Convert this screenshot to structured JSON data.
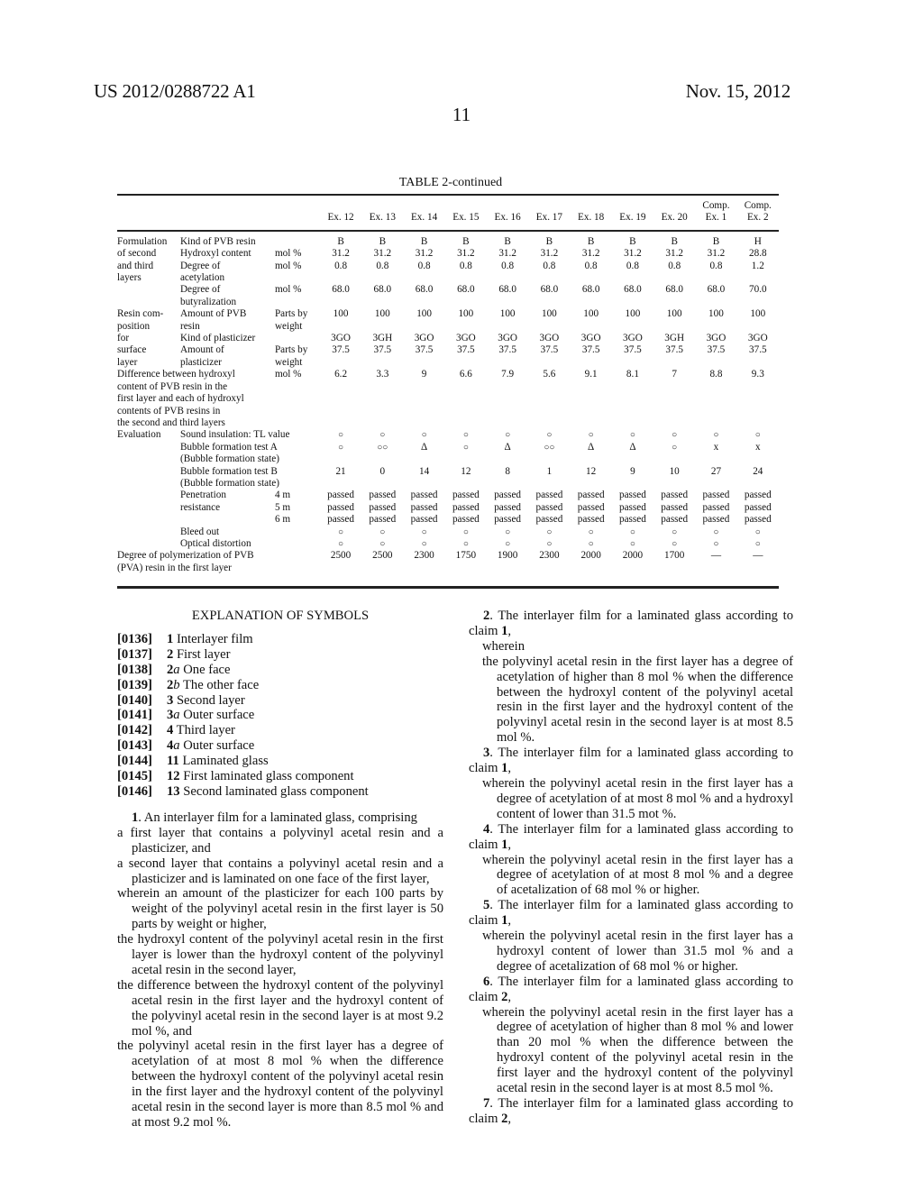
{
  "header": {
    "publication_number": "US 2012/0288722 A1",
    "date": "Nov. 15, 2012",
    "page_number": "11"
  },
  "table": {
    "title": "TABLE 2-continued",
    "columns": [
      "Ex. 12",
      "Ex. 13",
      "Ex. 14",
      "Ex. 15",
      "Ex. 16",
      "Ex. 17",
      "Ex. 18",
      "Ex. 19",
      "Ex. 20",
      "Comp.\nEx. 1",
      "Comp.\nEx. 2"
    ],
    "column_labels": [
      {
        "line1": "",
        "line2": "Ex. 12"
      },
      {
        "line1": "",
        "line2": "Ex. 13"
      },
      {
        "line1": "",
        "line2": "Ex. 14"
      },
      {
        "line1": "",
        "line2": "Ex. 15"
      },
      {
        "line1": "",
        "line2": "Ex. 16"
      },
      {
        "line1": "",
        "line2": "Ex. 17"
      },
      {
        "line1": "",
        "line2": "Ex. 18"
      },
      {
        "line1": "",
        "line2": "Ex. 19"
      },
      {
        "line1": "",
        "line2": "Ex. 20"
      },
      {
        "line1": "Comp.",
        "line2": "Ex. 1"
      },
      {
        "line1": "Comp.",
        "line2": "Ex. 2"
      }
    ],
    "rows": [
      {
        "group": "Formulation",
        "item": "Kind of PVB resin",
        "unit": "",
        "values": [
          "B",
          "B",
          "B",
          "B",
          "B",
          "B",
          "B",
          "B",
          "B",
          "B",
          "H"
        ]
      },
      {
        "group": "of second",
        "item": "Hydroxyl content",
        "unit": "mol %",
        "values": [
          "31.2",
          "31.2",
          "31.2",
          "31.2",
          "31.2",
          "31.2",
          "31.2",
          "31.2",
          "31.2",
          "31.2",
          "28.8"
        ]
      },
      {
        "group": "and third",
        "item": "Degree of",
        "unit": "mol %",
        "values": [
          "0.8",
          "0.8",
          "0.8",
          "0.8",
          "0.8",
          "0.8",
          "0.8",
          "0.8",
          "0.8",
          "0.8",
          "1.2"
        ]
      },
      {
        "group": "layers",
        "item": "acetylation",
        "unit": "",
        "values": [
          "",
          "",
          "",
          "",
          "",
          "",
          "",
          "",
          "",
          "",
          ""
        ]
      },
      {
        "group": "",
        "item": "Degree of",
        "unit": "mol %",
        "values": [
          "68.0",
          "68.0",
          "68.0",
          "68.0",
          "68.0",
          "68.0",
          "68.0",
          "68.0",
          "68.0",
          "68.0",
          "70.0"
        ]
      },
      {
        "group": "",
        "item": "butyralization",
        "unit": "",
        "values": [
          "",
          "",
          "",
          "",
          "",
          "",
          "",
          "",
          "",
          "",
          ""
        ]
      },
      {
        "group": "Resin com-",
        "item": "Amount of PVB",
        "unit": "Parts by",
        "values": [
          "100",
          "100",
          "100",
          "100",
          "100",
          "100",
          "100",
          "100",
          "100",
          "100",
          "100"
        ]
      },
      {
        "group": "position",
        "item": "resin",
        "unit": "weight",
        "values": [
          "",
          "",
          "",
          "",
          "",
          "",
          "",
          "",
          "",
          "",
          ""
        ]
      },
      {
        "group": "for",
        "item": "Kind of plasticizer",
        "unit": "",
        "values": [
          "3GO",
          "3GH",
          "3GO",
          "3GO",
          "3GO",
          "3GO",
          "3GO",
          "3GO",
          "3GH",
          "3GO",
          "3GO"
        ]
      },
      {
        "group": "surface",
        "item": "Amount of",
        "unit": "Parts by",
        "values": [
          "37.5",
          "37.5",
          "37.5",
          "37.5",
          "37.5",
          "37.5",
          "37.5",
          "37.5",
          "37.5",
          "37.5",
          "37.5"
        ]
      },
      {
        "group": "layer",
        "item": "plasticizer",
        "unit": "weight",
        "values": [
          "",
          "",
          "",
          "",
          "",
          "",
          "",
          "",
          "",
          "",
          ""
        ]
      },
      {
        "group": "Difference between hydroxyl",
        "item": "",
        "unit": "mol %",
        "span": true,
        "values": [
          "6.2",
          "3.3",
          "9",
          "6.6",
          "7.9",
          "5.6",
          "9.1",
          "8.1",
          "7",
          "8.8",
          "9.3"
        ]
      },
      {
        "group": "content of PVB resin in the",
        "item": "",
        "unit": "",
        "span": true,
        "values": [
          "",
          "",
          "",
          "",
          "",
          "",
          "",
          "",
          "",
          "",
          ""
        ]
      },
      {
        "group": "first layer and each of hydroxyl",
        "item": "",
        "unit": "",
        "span": true,
        "values": [
          "",
          "",
          "",
          "",
          "",
          "",
          "",
          "",
          "",
          "",
          ""
        ]
      },
      {
        "group": "contents of PVB resins in",
        "item": "",
        "unit": "",
        "span": true,
        "values": [
          "",
          "",
          "",
          "",
          "",
          "",
          "",
          "",
          "",
          "",
          ""
        ]
      },
      {
        "group": "the second and third layers",
        "item": "",
        "unit": "",
        "span": true,
        "values": [
          "",
          "",
          "",
          "",
          "",
          "",
          "",
          "",
          "",
          "",
          ""
        ]
      },
      {
        "group": "Evaluation",
        "item": "Sound insulation: TL value",
        "unit": "",
        "values": [
          "○",
          "○",
          "○",
          "○",
          "○",
          "○",
          "○",
          "○",
          "○",
          "○",
          "○"
        ]
      },
      {
        "group": "",
        "item": "Bubble formation test A",
        "unit": "",
        "values": [
          "○",
          "○○",
          "Δ",
          "○",
          "Δ",
          "○○",
          "Δ",
          "Δ",
          "○",
          "x",
          "x"
        ]
      },
      {
        "group": "",
        "item": "(Bubble formation state)",
        "unit": "",
        "values": [
          "",
          "",
          "",
          "",
          "",
          "",
          "",
          "",
          "",
          "",
          ""
        ]
      },
      {
        "group": "",
        "item": "Bubble formation test B",
        "unit": "",
        "values": [
          "21",
          "0",
          "14",
          "12",
          "8",
          "1",
          "12",
          "9",
          "10",
          "27",
          "24"
        ]
      },
      {
        "group": "",
        "item": "(Bubble formation state)",
        "unit": "",
        "values": [
          "",
          "",
          "",
          "",
          "",
          "",
          "",
          "",
          "",
          "",
          ""
        ]
      },
      {
        "group": "",
        "item": "Penetration",
        "unit": "4 m",
        "values": [
          "passed",
          "passed",
          "passed",
          "passed",
          "passed",
          "passed",
          "passed",
          "passed",
          "passed",
          "passed",
          "passed"
        ]
      },
      {
        "group": "",
        "item": "resistance",
        "unit": "5 m",
        "values": [
          "passed",
          "passed",
          "passed",
          "passed",
          "passed",
          "passed",
          "passed",
          "passed",
          "passed",
          "passed",
          "passed"
        ]
      },
      {
        "group": "",
        "item": "",
        "unit": "6 m",
        "values": [
          "passed",
          "passed",
          "passed",
          "passed",
          "passed",
          "passed",
          "passed",
          "passed",
          "passed",
          "passed",
          "passed"
        ]
      },
      {
        "group": "",
        "item": "Bleed out",
        "unit": "",
        "values": [
          "○",
          "○",
          "○",
          "○",
          "○",
          "○",
          "○",
          "○",
          "○",
          "○",
          "○"
        ]
      },
      {
        "group": "",
        "item": "Optical distortion",
        "unit": "",
        "values": [
          "○",
          "○",
          "○",
          "○",
          "○",
          "○",
          "○",
          "○",
          "○",
          "○",
          "○"
        ]
      },
      {
        "group": "Degree of polymerization of PVB",
        "item": "",
        "unit": "",
        "span": true,
        "values": [
          "2500",
          "2500",
          "2300",
          "1750",
          "1900",
          "2300",
          "2000",
          "2000",
          "1700",
          "—",
          "—"
        ]
      },
      {
        "group": "(PVA) resin in the first layer",
        "item": "",
        "unit": "",
        "span": true,
        "values": [
          "",
          "",
          "",
          "",
          "",
          "",
          "",
          "",
          "",
          "",
          ""
        ]
      }
    ]
  },
  "symbols": {
    "heading": "EXPLANATION OF SYMBOLS",
    "items": [
      {
        "para": "[0136]",
        "num": "1",
        "suffix": "",
        "text": " Interlayer film"
      },
      {
        "para": "[0137]",
        "num": "2",
        "suffix": "",
        "text": " First layer"
      },
      {
        "para": "[0138]",
        "num": "2",
        "suffix": "a",
        "text": " One face"
      },
      {
        "para": "[0139]",
        "num": "2",
        "suffix": "b",
        "text": " The other face"
      },
      {
        "para": "[0140]",
        "num": "3",
        "suffix": "",
        "text": " Second layer"
      },
      {
        "para": "[0141]",
        "num": "3",
        "suffix": "a",
        "text": " Outer surface"
      },
      {
        "para": "[0142]",
        "num": "4",
        "suffix": "",
        "text": " Third layer"
      },
      {
        "para": "[0143]",
        "num": "4",
        "suffix": "a",
        "text": " Outer surface"
      },
      {
        "para": "[0144]",
        "num": "11",
        "suffix": "",
        "text": " Laminated glass"
      },
      {
        "para": "[0145]",
        "num": "12",
        "suffix": "",
        "text": " First laminated glass component"
      },
      {
        "para": "[0146]",
        "num": "13",
        "suffix": "",
        "text": " Second laminated glass component"
      }
    ]
  },
  "claims": {
    "claim1": {
      "num": "1",
      "intro": ". An interlayer film for a laminated glass, comprising",
      "parts": [
        "a first layer that contains a polyvinyl acetal resin and a plasticizer, and",
        "a second layer that contains a polyvinyl acetal resin and a plasticizer and is laminated on one face of the first layer,",
        "wherein an amount of the plasticizer for each 100 parts by weight of the polyvinyl acetal resin in the first layer is 50 parts by weight or higher,",
        "the hydroxyl content of the polyvinyl acetal resin in the first layer is lower than the hydroxyl content of the polyvinyl acetal resin in the second layer,",
        "the difference between the hydroxyl content of the polyvinyl acetal resin in the first layer and the hydroxyl content of the polyvinyl acetal resin in the second layer is at most 9.2 mol %, and",
        "the polyvinyl acetal resin in the first layer has a degree of acetylation of at most 8 mol % when the difference between the hydroxyl content of the polyvinyl acetal resin in the first layer and the hydroxyl content of the polyvinyl acetal resin in the second layer is more than 8.5 mol % and at most 9.2 mol %."
      ]
    },
    "dependent": [
      {
        "num": "2",
        "head": ". The interlayer film for a laminated glass according to claim ",
        "ref": "1",
        "tail": ",",
        "parts": [
          "wherein",
          "the polyvinyl acetal resin in the first layer has a degree of acetylation of higher than 8 mol % when the difference between the hydroxyl content of the polyvinyl acetal resin in the first layer and the hydroxyl content of the polyvinyl acetal resin in the second layer is at most 8.5 mol %."
        ]
      },
      {
        "num": "3",
        "head": ". The interlayer film for a laminated glass according to claim ",
        "ref": "1",
        "tail": ",",
        "parts": [
          "wherein the polyvinyl acetal resin in the first layer has a degree of acetylation of at most 8 mol % and a hydroxyl content of lower than 31.5 mot %."
        ]
      },
      {
        "num": "4",
        "head": ". The interlayer film for a laminated glass according to claim ",
        "ref": "1",
        "tail": ",",
        "parts": [
          "wherein the polyvinyl acetal resin in the first layer has a degree of acetylation of at most 8 mol % and a degree of acetalization of 68 mol % or higher."
        ]
      },
      {
        "num": "5",
        "head": ". The interlayer film for a laminated glass according to claim ",
        "ref": "1",
        "tail": ",",
        "parts": [
          "wherein the polyvinyl acetal resin in the first layer has a hydroxyl content of lower than 31.5 mol % and a degree of acetalization of 68 mol % or higher."
        ]
      },
      {
        "num": "6",
        "head": ". The interlayer film for a laminated glass according to claim ",
        "ref": "2",
        "tail": ",",
        "parts": [
          "wherein the polyvinyl acetal resin in the first layer has a degree of acetylation of higher than 8 mol % and lower than 20 mol % when the difference between the hydroxyl content of the polyvinyl acetal resin in the first layer and the hydroxyl content of the polyvinyl acetal resin in the second layer is at most 8.5 mol %."
        ]
      },
      {
        "num": "7",
        "head": ". The interlayer film for a laminated glass according to claim ",
        "ref": "2",
        "tail": ",",
        "parts": []
      }
    ]
  }
}
